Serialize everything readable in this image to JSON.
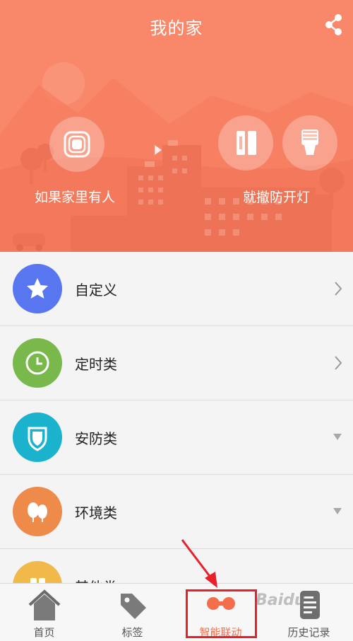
{
  "header": {
    "title": "我的家"
  },
  "scene": {
    "condition_label": "如果家里有人",
    "action_label": "就撤防开灯"
  },
  "categories": [
    {
      "label": "自定义",
      "icon": "star-icon",
      "color": "#5876f0",
      "indicator": "chevron"
    },
    {
      "label": "定时类",
      "icon": "clock-icon",
      "color": "#79b84a",
      "indicator": "chevron"
    },
    {
      "label": "安防类",
      "icon": "shield-icon",
      "color": "#1bb2cd",
      "indicator": "triangle"
    },
    {
      "label": "环境类",
      "icon": "tree-icon",
      "color": "#ee8a4a",
      "indicator": "triangle"
    },
    {
      "label": "其他类",
      "icon": "other-icon",
      "color": "#f0b94a",
      "indicator": "none"
    }
  ],
  "tabbar": {
    "tabs": [
      {
        "label": "首页",
        "icon": "home-icon"
      },
      {
        "label": "标签",
        "icon": "tag-icon"
      },
      {
        "label": "智能联动",
        "icon": "link-icon",
        "active": true
      },
      {
        "label": "历史记录",
        "icon": "history-icon"
      }
    ]
  },
  "colors": {
    "hero_bg": "#f9876a",
    "accent": "#f46e4e",
    "annotation": "#e8202a"
  },
  "watermark": "Baidu"
}
